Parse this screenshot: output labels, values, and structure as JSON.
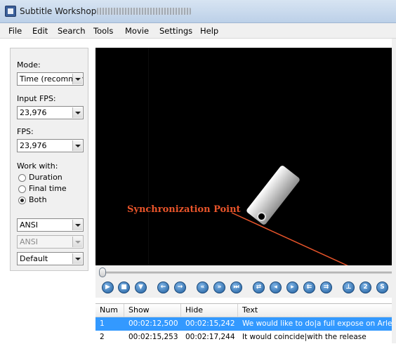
{
  "window": {
    "title": "Subtitle Workshop"
  },
  "menu": [
    "File",
    "Edit",
    "Search",
    "Tools",
    "Movie",
    "Settings",
    "Help"
  ],
  "left_panel": {
    "mode_label": "Mode:",
    "mode_value": "Time (recommen",
    "input_fps_label": "Input FPS:",
    "input_fps_value": "23,976",
    "fps_label": "FPS:",
    "fps_value": "23,976",
    "work_with_label": "Work with:",
    "options": [
      "Duration",
      "Final time",
      "Both"
    ],
    "selected_option": "Both",
    "encoding_value": "ANSI",
    "encoding2_value": "ANSI",
    "style_value": "Default"
  },
  "annotation": "Synchronization Point",
  "controls": [
    "play",
    "stop",
    "down",
    "back",
    "forward",
    "rewind",
    "fast-forward",
    "skip",
    "loop",
    "set-start",
    "set-end",
    "prev-subtitle",
    "next-subtitle",
    "start-sync",
    "end-sync",
    "sync"
  ],
  "grid": {
    "columns": [
      "Num",
      "Show",
      "Hide",
      "Text"
    ],
    "rows": [
      {
        "num": "1",
        "show": "00:02:12,500",
        "hide": "00:02:15,242",
        "text": "We would like to do|a full expose on Arlen Fa"
      },
      {
        "num": "2",
        "show": "00:02:15,253",
        "hide": "00:02:17,244",
        "text": "It would coincide|with the release"
      }
    ],
    "selected_row": 0
  },
  "colors": {
    "annotation": "#e8542a",
    "selection": "#3399ff"
  }
}
